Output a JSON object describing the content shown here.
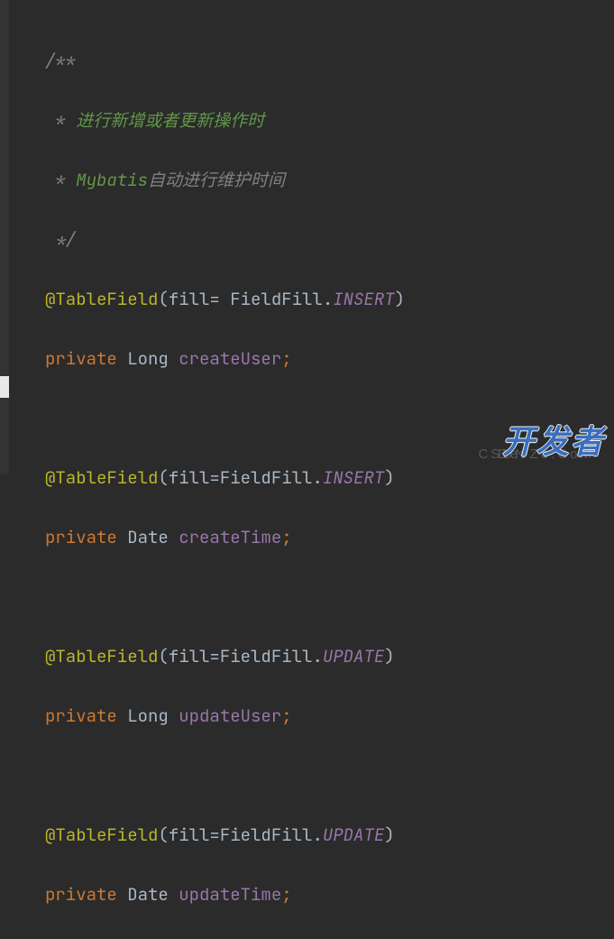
{
  "code": {
    "comment_open": "/**",
    "comment_line1_prefix": " * ",
    "comment_line1_text": "进行新增或者更新操作时",
    "comment_line2_prefix": " * ",
    "comment_line2_em": "Mybatis",
    "comment_line2_rest": "自动进行维护时间",
    "comment_close": " */",
    "anno": "@TableField",
    "paren_open": "(",
    "paren_close": ")",
    "fill_eq_sp": "fill= ",
    "fill_eq": "fill=",
    "enum_class": "FieldFill",
    "dot": ".",
    "insert": "INSERT",
    "update": "UPDATE",
    "kw_private": "private",
    "sp": " ",
    "type_long": "Long",
    "type_date": "Date",
    "f_createUser": "createUser",
    "f_createTime": "createTime",
    "f_updateUser": "updateUser",
    "f_updateTime": "updateTime",
    "semi": ";"
  },
  "watermark": {
    "big": "开发者",
    "small_a": "DevZe.CoM",
    "small_b": "CSDN"
  }
}
